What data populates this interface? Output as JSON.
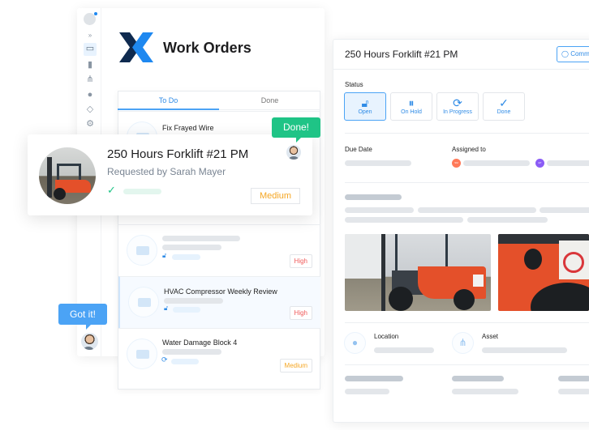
{
  "app": {
    "title": "Work Orders"
  },
  "sidebar": {
    "items": [
      {
        "icon": "avatar-icon"
      },
      {
        "icon": "expand-icon",
        "label": "»"
      },
      {
        "icon": "inbox-icon"
      },
      {
        "icon": "bar-chart-icon"
      },
      {
        "icon": "hierarchy-icon"
      },
      {
        "icon": "chat-icon"
      },
      {
        "icon": "tag-icon"
      },
      {
        "icon": "gear-icon"
      }
    ]
  },
  "tabs": [
    {
      "label": "To Do",
      "active": true
    },
    {
      "label": "Done"
    }
  ],
  "list": {
    "items": [
      {
        "title": "Fix Frayed Wire"
      },
      {
        "title": "",
        "priority": "High",
        "status_icon": "lock-open-icon"
      },
      {
        "title": "HVAC Compressor Weekly Review",
        "priority": "High",
        "status_icon": "lock-open-icon"
      },
      {
        "title": "Water Damage Block 4",
        "priority": "Medium",
        "status_icon": "refresh-icon"
      }
    ]
  },
  "floating_card": {
    "title": "250 Hours Forklift #21 PM",
    "requested": "Requested by Sarah Mayer",
    "priority": "Medium"
  },
  "bubbles": {
    "done": "Done!",
    "got_it": "Got it!"
  },
  "detail": {
    "title": "250 Hours Forklift #21 PM",
    "comment_label": "Comm",
    "status_label": "Status",
    "statuses": [
      {
        "label": "Open",
        "icon": "lock-open-icon",
        "active": true
      },
      {
        "label": "On Hold",
        "icon": "pause-icon"
      },
      {
        "label": "In Progress",
        "icon": "refresh-icon"
      },
      {
        "label": "Done",
        "icon": "check-icon"
      }
    ],
    "due_date_label": "Due Date",
    "assigned_label": "Assigned to",
    "assignees": [
      {
        "initials": "SM",
        "color": "#ff7a59"
      },
      {
        "initials": "ET",
        "color": "#8b5cf6"
      }
    ],
    "location_label": "Location",
    "asset_label": "Asset"
  },
  "colors": {
    "accent": "#2f8be6",
    "green": "#1fc486",
    "logo_dark": "#0f2a4f",
    "logo_blue": "#1e88f0",
    "high": "#f05a5a",
    "medium": "#f5a623"
  }
}
